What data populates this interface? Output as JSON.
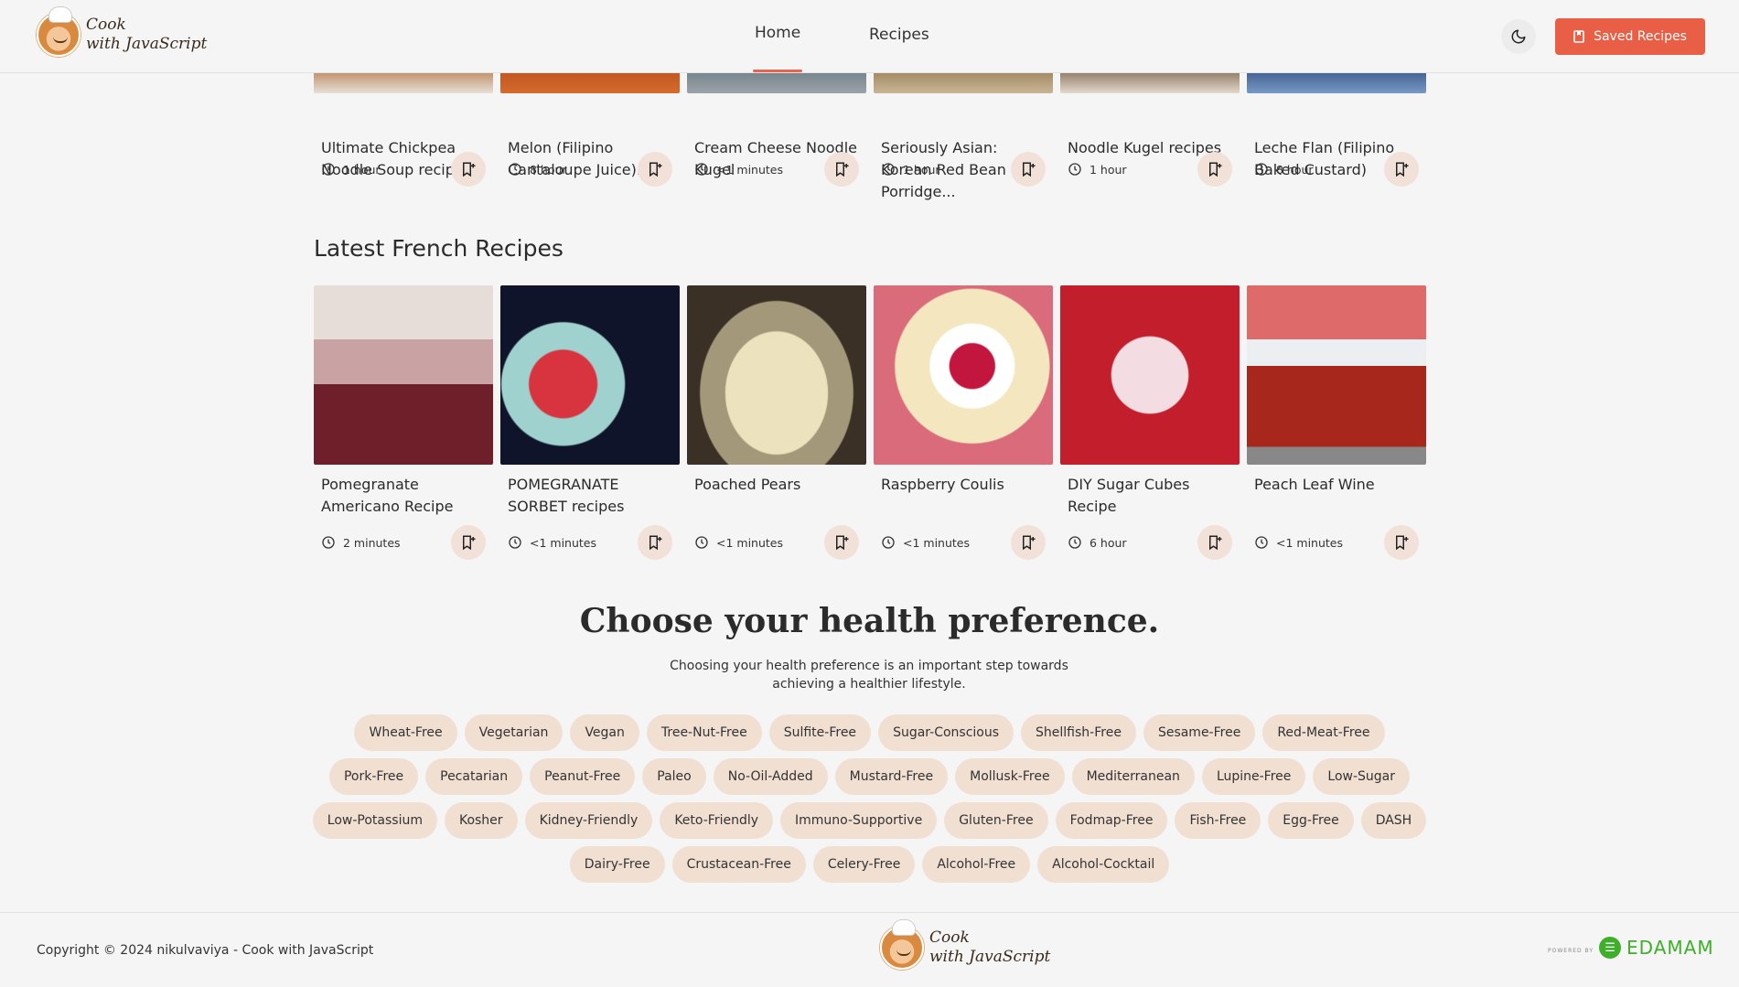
{
  "header": {
    "logo_line1": "Cook",
    "logo_line2": "with JavaScript",
    "nav": {
      "home": "Home",
      "recipes": "Recipes"
    },
    "theme_icon": "moon-icon",
    "saved_label": "Saved Recipes",
    "accent_color": "#e85f46"
  },
  "top_row": {
    "cards": [
      {
        "title": "Ultimate Chickpea Noodle Soup recipes",
        "time": "1 hour"
      },
      {
        "title": "Melon (Filipino Cantaloupe Juice)...",
        "time": "8 hour"
      },
      {
        "title": "Cream Cheese Noodle Kugel",
        "time": "<1 minutes"
      },
      {
        "title": "Seriously Asian: Korean Red Bean Porridge...",
        "time": "1 hour"
      },
      {
        "title": "Noodle Kugel recipes",
        "time": "1 hour"
      },
      {
        "title": "Leche Flan (Filipino Baked Custard)",
        "time": "8 hour"
      }
    ]
  },
  "french": {
    "title": "Latest French Recipes",
    "cards": [
      {
        "title": "Pomegranate Americano Recipe",
        "time": "2 minutes"
      },
      {
        "title": "POMEGRANATE SORBET recipes",
        "time": "<1 minutes"
      },
      {
        "title": "Poached Pears",
        "time": "<1 minutes"
      },
      {
        "title": "Raspberry Coulis",
        "time": "<1 minutes"
      },
      {
        "title": "DIY Sugar Cubes Recipe",
        "time": "6 hour"
      },
      {
        "title": "Peach Leaf Wine",
        "time": "<1 minutes"
      }
    ]
  },
  "health": {
    "title": "Choose your health preference.",
    "subtitle": "Choosing your health preference is an important step towards achieving a healthier lifestyle.",
    "rows": [
      [
        "Wheat-Free",
        "Vegetarian",
        "Vegan",
        "Tree-Nut-Free",
        "Sulfite-Free",
        "Sugar-Conscious",
        "Shellfish-Free",
        "Sesame-Free",
        "Red-Meat-Free"
      ],
      [
        "Pork-Free",
        "Pecatarian",
        "Peanut-Free",
        "Paleo",
        "No-Oil-Added",
        "Mustard-Free",
        "Mollusk-Free",
        "Mediterranean",
        "Lupine-Free",
        "Low-Sugar"
      ],
      [
        "Low-Potassium",
        "Kosher",
        "Kidney-Friendly",
        "Keto-Friendly",
        "Immuno-Supportive",
        "Gluten-Free",
        "Fodmap-Free",
        "Fish-Free",
        "Egg-Free",
        "DASH"
      ],
      [
        "Dairy-Free",
        "Crustacean-Free",
        "Celery-Free",
        "Alcohol-Free",
        "Alcohol-Cocktail"
      ]
    ]
  },
  "footer": {
    "copyright": "Copyright © 2024 nikulvaviya - Cook with JavaScript",
    "logo_line1": "Cook",
    "logo_line2": "with JavaScript",
    "powered_by": "POWERED BY",
    "edamam": "EDAMAM",
    "edamam_color": "#3fae2a"
  }
}
